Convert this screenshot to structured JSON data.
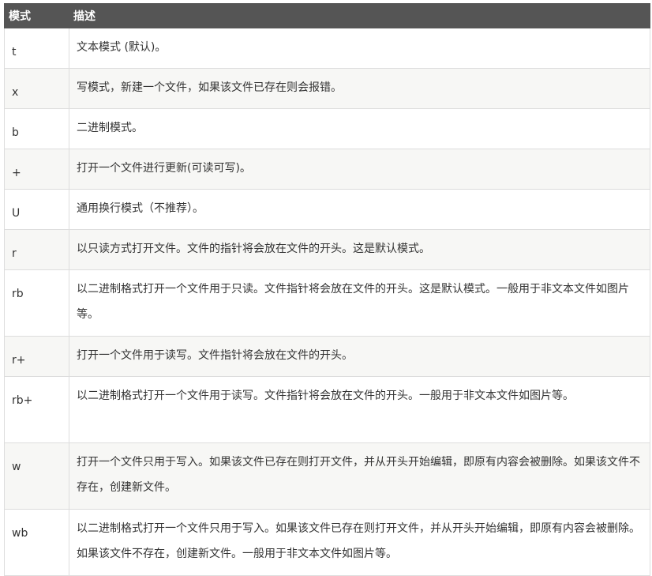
{
  "table": {
    "headers": {
      "mode": "模式",
      "description": "描述"
    },
    "rows": [
      {
        "mode": "t",
        "description": "文本模式 (默认)。"
      },
      {
        "mode": "x",
        "description": "写模式，新建一个文件，如果该文件已存在则会报错。"
      },
      {
        "mode": "b",
        "description": "二进制模式。"
      },
      {
        "mode": "+",
        "description": "打开一个文件进行更新(可读可写)。"
      },
      {
        "mode": "U",
        "description": "通用换行模式（不推荐）。"
      },
      {
        "mode": "r",
        "description": "以只读方式打开文件。文件的指针将会放在文件的开头。这是默认模式。"
      },
      {
        "mode": "rb",
        "description": "以二进制格式打开一个文件用于只读。文件指针将会放在文件的开头。这是默认模式。一般用于非文本文件如图片等。"
      },
      {
        "mode": "r+",
        "description": "打开一个文件用于读写。文件指针将会放在文件的开头。"
      },
      {
        "mode": "rb+",
        "description": "以二进制格式打开一个文件用于读写。文件指针将会放在文件的开头。一般用于非文本文件如图片等。"
      },
      {
        "mode": "w",
        "description": "打开一个文件只用于写入。如果该文件已存在则打开文件，并从开头开始编辑，即原有内容会被删除。如果该文件不存在，创建新文件。"
      },
      {
        "mode": "wb",
        "description": "以二进制格式打开一个文件只用于写入。如果该文件已存在则打开文件，并从开头开始编辑，即原有内容会被删除。如果该文件不存在，创建新文件。一般用于非文本文件如图片等。"
      }
    ]
  },
  "colors": {
    "header_bg": "#555555",
    "header_text": "#ffffff",
    "row_alt_bg": "#f7f7f5",
    "border": "#dddddd",
    "text": "#333333"
  }
}
